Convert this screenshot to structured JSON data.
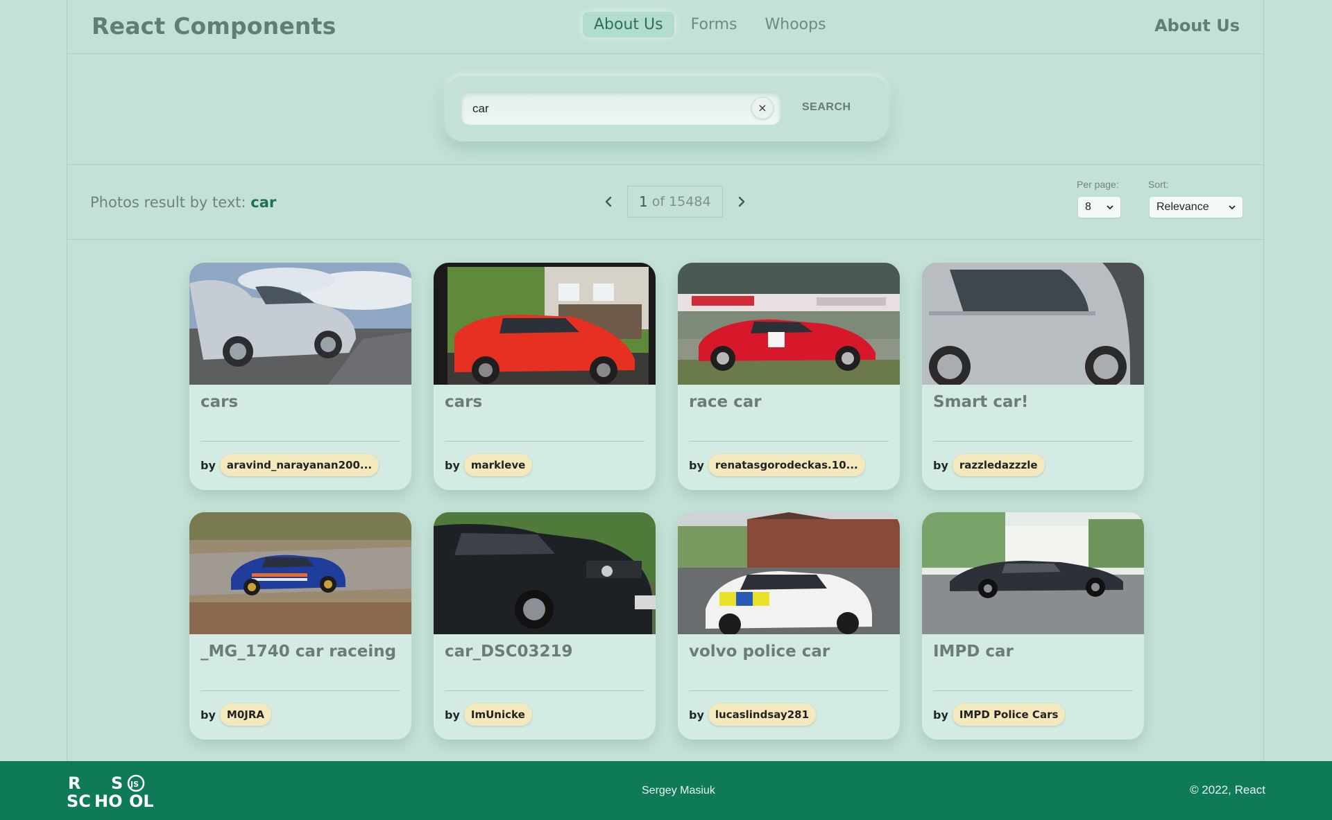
{
  "header": {
    "brand": "React Components",
    "nav": [
      {
        "label": "About Us",
        "active": true
      },
      {
        "label": "Forms",
        "active": false
      },
      {
        "label": "Whoops",
        "active": false
      }
    ],
    "current_page": "About Us"
  },
  "search": {
    "value": "car",
    "clear_label": "×",
    "button_label": "SEARCH"
  },
  "results": {
    "prefix": "Photos result by text:",
    "query": "car"
  },
  "pagination": {
    "current": "1",
    "total_text": "of 15484"
  },
  "per_page": {
    "label": "Per page:",
    "value": "8"
  },
  "sort": {
    "label": "Sort:",
    "value": "Relevance"
  },
  "cards": [
    {
      "title": "cars",
      "by": "by",
      "author": "aravind_narayanan200..."
    },
    {
      "title": "cars",
      "by": "by",
      "author": "markleve"
    },
    {
      "title": "race car",
      "by": "by",
      "author": "renatasgorodeckas.10..."
    },
    {
      "title": "Smart car!",
      "by": "by",
      "author": "razzledazzzle"
    },
    {
      "title": "_MG_1740 car raceing",
      "by": "by",
      "author": "M0JRA"
    },
    {
      "title": "car_DSC03219",
      "by": "by",
      "author": "ImUnicke"
    },
    {
      "title": "volvo police car",
      "by": "by",
      "author": "lucaslindsay281"
    },
    {
      "title": "IMPD car",
      "by": "by",
      "author": "IMPD Police Cars"
    }
  ],
  "footer": {
    "logo_text": [
      "R",
      "S",
      "SC",
      "HO",
      "OL",
      "JS"
    ],
    "author": "Sergey Masiuk",
    "copyright": "© 2022, React"
  },
  "colors": {
    "background": "#c3e1d6",
    "accent": "#2e6f5a",
    "footer": "#0e7a57",
    "author_chip": "#f3e9bd"
  }
}
